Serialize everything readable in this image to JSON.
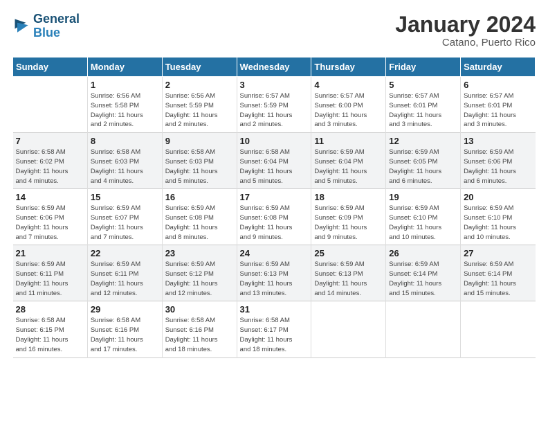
{
  "header": {
    "logo_general": "General",
    "logo_blue": "Blue",
    "month_title": "January 2024",
    "location": "Catano, Puerto Rico"
  },
  "days_of_week": [
    "Sunday",
    "Monday",
    "Tuesday",
    "Wednesday",
    "Thursday",
    "Friday",
    "Saturday"
  ],
  "weeks": [
    [
      {
        "day": "",
        "info": ""
      },
      {
        "day": "1",
        "info": "Sunrise: 6:56 AM\nSunset: 5:58 PM\nDaylight: 11 hours\nand 2 minutes."
      },
      {
        "day": "2",
        "info": "Sunrise: 6:56 AM\nSunset: 5:59 PM\nDaylight: 11 hours\nand 2 minutes."
      },
      {
        "day": "3",
        "info": "Sunrise: 6:57 AM\nSunset: 5:59 PM\nDaylight: 11 hours\nand 2 minutes."
      },
      {
        "day": "4",
        "info": "Sunrise: 6:57 AM\nSunset: 6:00 PM\nDaylight: 11 hours\nand 3 minutes."
      },
      {
        "day": "5",
        "info": "Sunrise: 6:57 AM\nSunset: 6:01 PM\nDaylight: 11 hours\nand 3 minutes."
      },
      {
        "day": "6",
        "info": "Sunrise: 6:57 AM\nSunset: 6:01 PM\nDaylight: 11 hours\nand 3 minutes."
      }
    ],
    [
      {
        "day": "7",
        "info": "Sunrise: 6:58 AM\nSunset: 6:02 PM\nDaylight: 11 hours\nand 4 minutes."
      },
      {
        "day": "8",
        "info": "Sunrise: 6:58 AM\nSunset: 6:03 PM\nDaylight: 11 hours\nand 4 minutes."
      },
      {
        "day": "9",
        "info": "Sunrise: 6:58 AM\nSunset: 6:03 PM\nDaylight: 11 hours\nand 5 minutes."
      },
      {
        "day": "10",
        "info": "Sunrise: 6:58 AM\nSunset: 6:04 PM\nDaylight: 11 hours\nand 5 minutes."
      },
      {
        "day": "11",
        "info": "Sunrise: 6:59 AM\nSunset: 6:04 PM\nDaylight: 11 hours\nand 5 minutes."
      },
      {
        "day": "12",
        "info": "Sunrise: 6:59 AM\nSunset: 6:05 PM\nDaylight: 11 hours\nand 6 minutes."
      },
      {
        "day": "13",
        "info": "Sunrise: 6:59 AM\nSunset: 6:06 PM\nDaylight: 11 hours\nand 6 minutes."
      }
    ],
    [
      {
        "day": "14",
        "info": "Sunrise: 6:59 AM\nSunset: 6:06 PM\nDaylight: 11 hours\nand 7 minutes."
      },
      {
        "day": "15",
        "info": "Sunrise: 6:59 AM\nSunset: 6:07 PM\nDaylight: 11 hours\nand 7 minutes."
      },
      {
        "day": "16",
        "info": "Sunrise: 6:59 AM\nSunset: 6:08 PM\nDaylight: 11 hours\nand 8 minutes."
      },
      {
        "day": "17",
        "info": "Sunrise: 6:59 AM\nSunset: 6:08 PM\nDaylight: 11 hours\nand 9 minutes."
      },
      {
        "day": "18",
        "info": "Sunrise: 6:59 AM\nSunset: 6:09 PM\nDaylight: 11 hours\nand 9 minutes."
      },
      {
        "day": "19",
        "info": "Sunrise: 6:59 AM\nSunset: 6:10 PM\nDaylight: 11 hours\nand 10 minutes."
      },
      {
        "day": "20",
        "info": "Sunrise: 6:59 AM\nSunset: 6:10 PM\nDaylight: 11 hours\nand 10 minutes."
      }
    ],
    [
      {
        "day": "21",
        "info": "Sunrise: 6:59 AM\nSunset: 6:11 PM\nDaylight: 11 hours\nand 11 minutes."
      },
      {
        "day": "22",
        "info": "Sunrise: 6:59 AM\nSunset: 6:11 PM\nDaylight: 11 hours\nand 12 minutes."
      },
      {
        "day": "23",
        "info": "Sunrise: 6:59 AM\nSunset: 6:12 PM\nDaylight: 11 hours\nand 12 minutes."
      },
      {
        "day": "24",
        "info": "Sunrise: 6:59 AM\nSunset: 6:13 PM\nDaylight: 11 hours\nand 13 minutes."
      },
      {
        "day": "25",
        "info": "Sunrise: 6:59 AM\nSunset: 6:13 PM\nDaylight: 11 hours\nand 14 minutes."
      },
      {
        "day": "26",
        "info": "Sunrise: 6:59 AM\nSunset: 6:14 PM\nDaylight: 11 hours\nand 15 minutes."
      },
      {
        "day": "27",
        "info": "Sunrise: 6:59 AM\nSunset: 6:14 PM\nDaylight: 11 hours\nand 15 minutes."
      }
    ],
    [
      {
        "day": "28",
        "info": "Sunrise: 6:58 AM\nSunset: 6:15 PM\nDaylight: 11 hours\nand 16 minutes."
      },
      {
        "day": "29",
        "info": "Sunrise: 6:58 AM\nSunset: 6:16 PM\nDaylight: 11 hours\nand 17 minutes."
      },
      {
        "day": "30",
        "info": "Sunrise: 6:58 AM\nSunset: 6:16 PM\nDaylight: 11 hours\nand 18 minutes."
      },
      {
        "day": "31",
        "info": "Sunrise: 6:58 AM\nSunset: 6:17 PM\nDaylight: 11 hours\nand 18 minutes."
      },
      {
        "day": "",
        "info": ""
      },
      {
        "day": "",
        "info": ""
      },
      {
        "day": "",
        "info": ""
      }
    ]
  ]
}
